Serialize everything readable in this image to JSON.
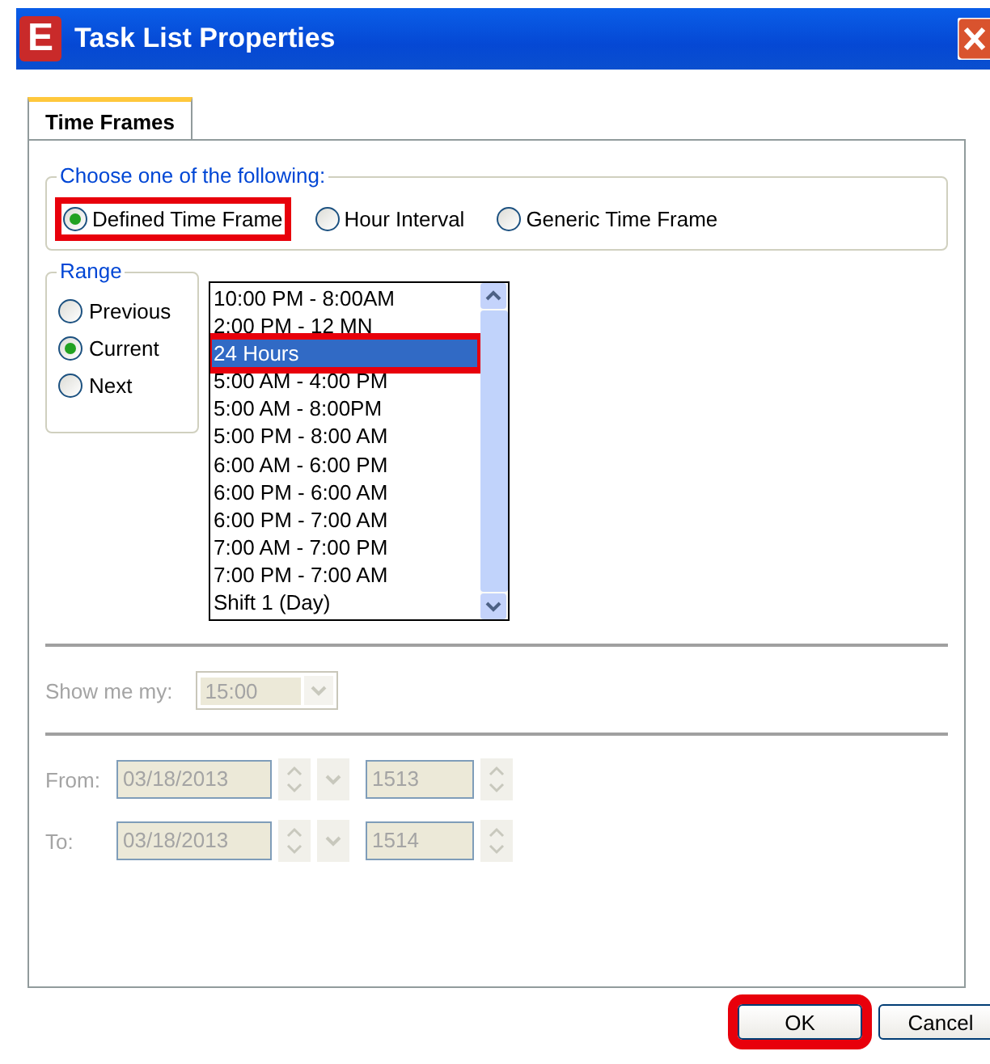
{
  "window": {
    "icon_letter": "E",
    "title": "Task List Properties"
  },
  "tabs": [
    {
      "label": "Time Frames",
      "selected": true
    }
  ],
  "choice_group": {
    "legend": "Choose one of the following:",
    "options": [
      {
        "label": "Defined Time Frame",
        "selected": true,
        "highlighted": true
      },
      {
        "label": "Hour Interval",
        "selected": false,
        "highlighted": false
      },
      {
        "label": "Generic Time Frame",
        "selected": false,
        "highlighted": false
      }
    ]
  },
  "range_group": {
    "legend": "Range",
    "options": [
      {
        "label": "Previous",
        "selected": false
      },
      {
        "label": "Current",
        "selected": true
      },
      {
        "label": "Next",
        "selected": false
      }
    ]
  },
  "time_frame_list": [
    {
      "label": "10:00 PM - 8:00AM",
      "selected": false,
      "highlighted": false
    },
    {
      "label": "2:00 PM - 12 MN",
      "selected": false,
      "highlighted": false
    },
    {
      "label": "24 Hours",
      "selected": true,
      "highlighted": true
    },
    {
      "label": "5:00 AM - 4:00 PM",
      "selected": false,
      "highlighted": false
    },
    {
      "label": "5:00 AM - 8:00PM",
      "selected": false,
      "highlighted": false
    },
    {
      "label": "5:00 PM - 8:00 AM",
      "selected": false,
      "highlighted": false
    },
    {
      "label": "6:00 AM - 6:00 PM",
      "selected": false,
      "highlighted": false
    },
    {
      "label": "6:00 PM - 6:00 AM",
      "selected": false,
      "highlighted": false
    },
    {
      "label": "6:00 PM - 7:00 AM",
      "selected": false,
      "highlighted": false
    },
    {
      "label": "7:00 AM - 7:00 PM",
      "selected": false,
      "highlighted": false
    },
    {
      "label": "7:00 PM - 7:00 AM",
      "selected": false,
      "highlighted": false
    },
    {
      "label": "Shift 1 (Day)",
      "selected": false,
      "highlighted": false
    }
  ],
  "show_me_my": {
    "label": "Show me my:",
    "value": "15:00",
    "disabled": true
  },
  "from": {
    "label": "From:",
    "date": "03/18/2013",
    "time": "1513",
    "disabled": true
  },
  "to": {
    "label": "To:",
    "date": "03/18/2013",
    "time": "1514",
    "disabled": true
  },
  "buttons": [
    {
      "label": "OK",
      "highlighted": true
    },
    {
      "label": "Cancel",
      "highlighted": false
    }
  ]
}
